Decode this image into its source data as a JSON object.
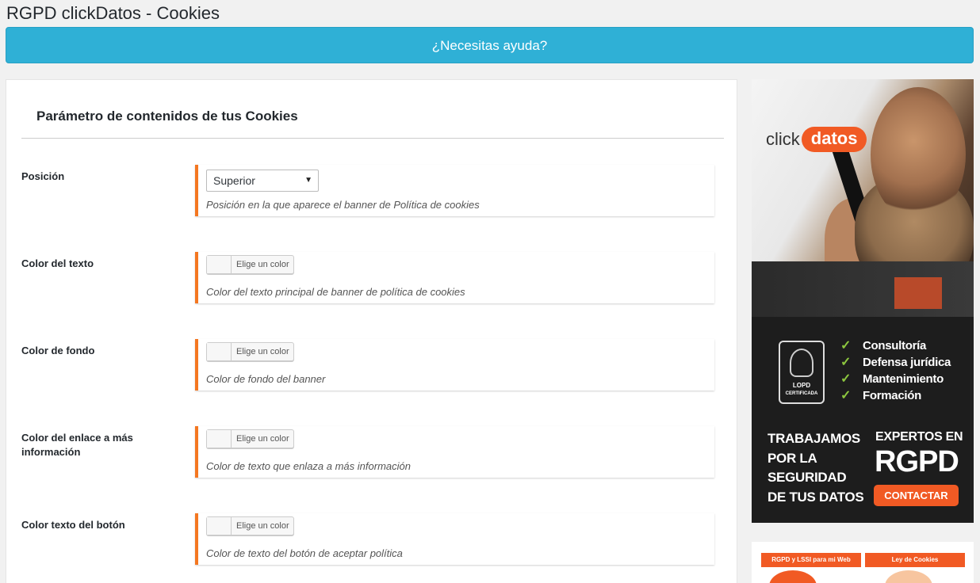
{
  "page": {
    "title": "RGPD clickDatos - Cookies"
  },
  "help": {
    "label": "¿Necesitas ayuda?"
  },
  "section": {
    "title": "Parámetro de contenidos de tus Cookies"
  },
  "fields": [
    {
      "label": "Posición",
      "type": "select",
      "value": "Superior",
      "description": "Posición en la que aparece el banner de Política de cookies"
    },
    {
      "label": "Color del texto",
      "type": "color",
      "button": "Elige un color",
      "description": "Color del texto principal de banner de política de cookies"
    },
    {
      "label": "Color de fondo",
      "type": "color",
      "button": "Elige un color",
      "description": "Color de fondo del banner"
    },
    {
      "label": "Color del enlace a más información",
      "type": "color",
      "button": "Elige un color",
      "description": "Color de texto que enlaza a más información"
    },
    {
      "label": "Color texto del botón",
      "type": "color",
      "button": "Elige un color",
      "description": "Color de texto del botón de aceptar política"
    }
  ],
  "ad": {
    "logo_click": "click",
    "logo_datos": "datos",
    "badge_title": "LOPD",
    "badge_sub": "CERTIFICADA",
    "services": [
      "Consultoría",
      "Defensa jurídica",
      "Mantenimiento",
      "Formación"
    ],
    "slogan": [
      "TRABAJAMOS",
      "POR LA",
      "SEGURIDAD",
      "DE TUS DATOS"
    ],
    "experts": "EXPERTOS EN",
    "rgpd": "RGPD",
    "contact": "CONTACTAR",
    "check_icon": "check-icon"
  },
  "ad2": {
    "tag_left": "RGPD y LSSI para mi Web",
    "tag_right": "Ley de Cookies"
  },
  "colors": {
    "accent_orange": "#f47721",
    "help_blue": "#2fb0d6",
    "brand_orange": "#f15a24",
    "check_green": "#8cc63f"
  }
}
